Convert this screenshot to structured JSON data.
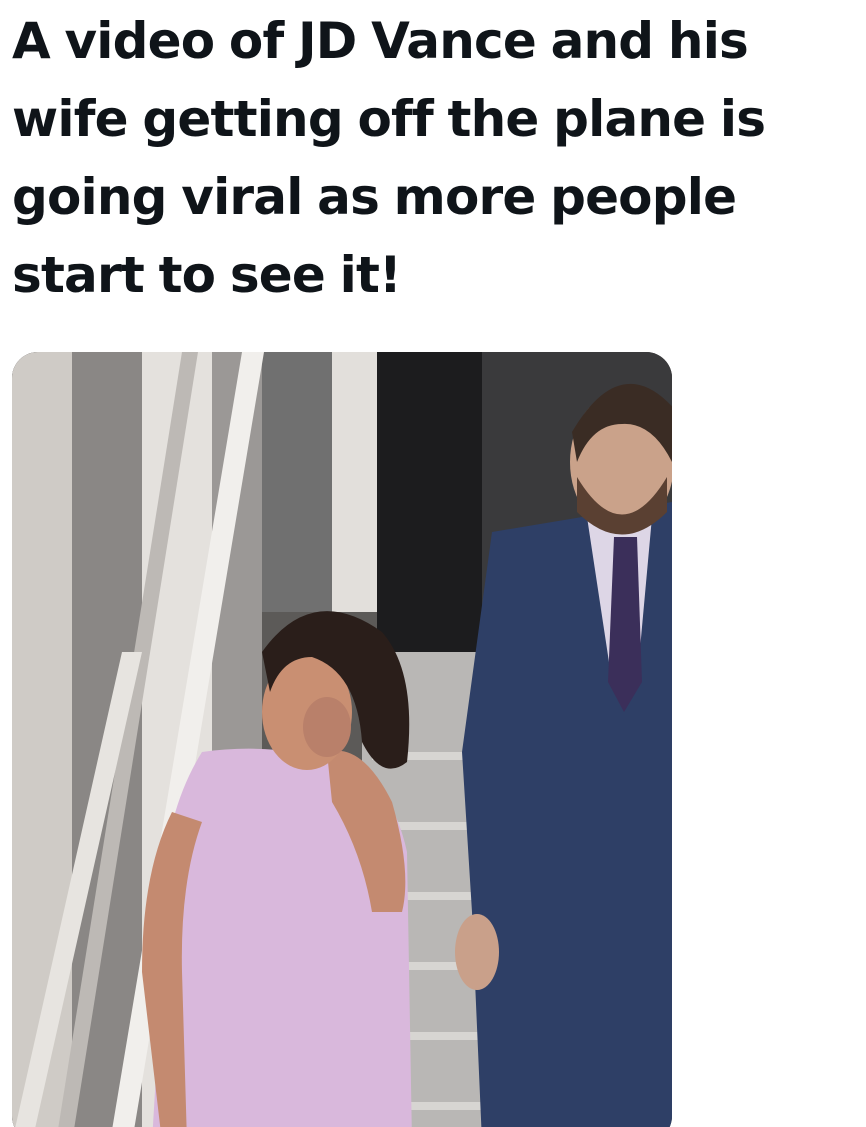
{
  "post": {
    "headline": "A video of JD Vance and his wife getting off the plane is going viral as more people start to see it!"
  },
  "media": {
    "type": "video-still",
    "scene": "plane-stairs-arrival",
    "colors": {
      "stair_rail": "#d9d6d2",
      "doorway": "#1c1c1e",
      "suit": "#2e3f66",
      "dress": "#d9b8dc",
      "hair": "#2a1e1a",
      "skin": "#c98f72"
    }
  }
}
